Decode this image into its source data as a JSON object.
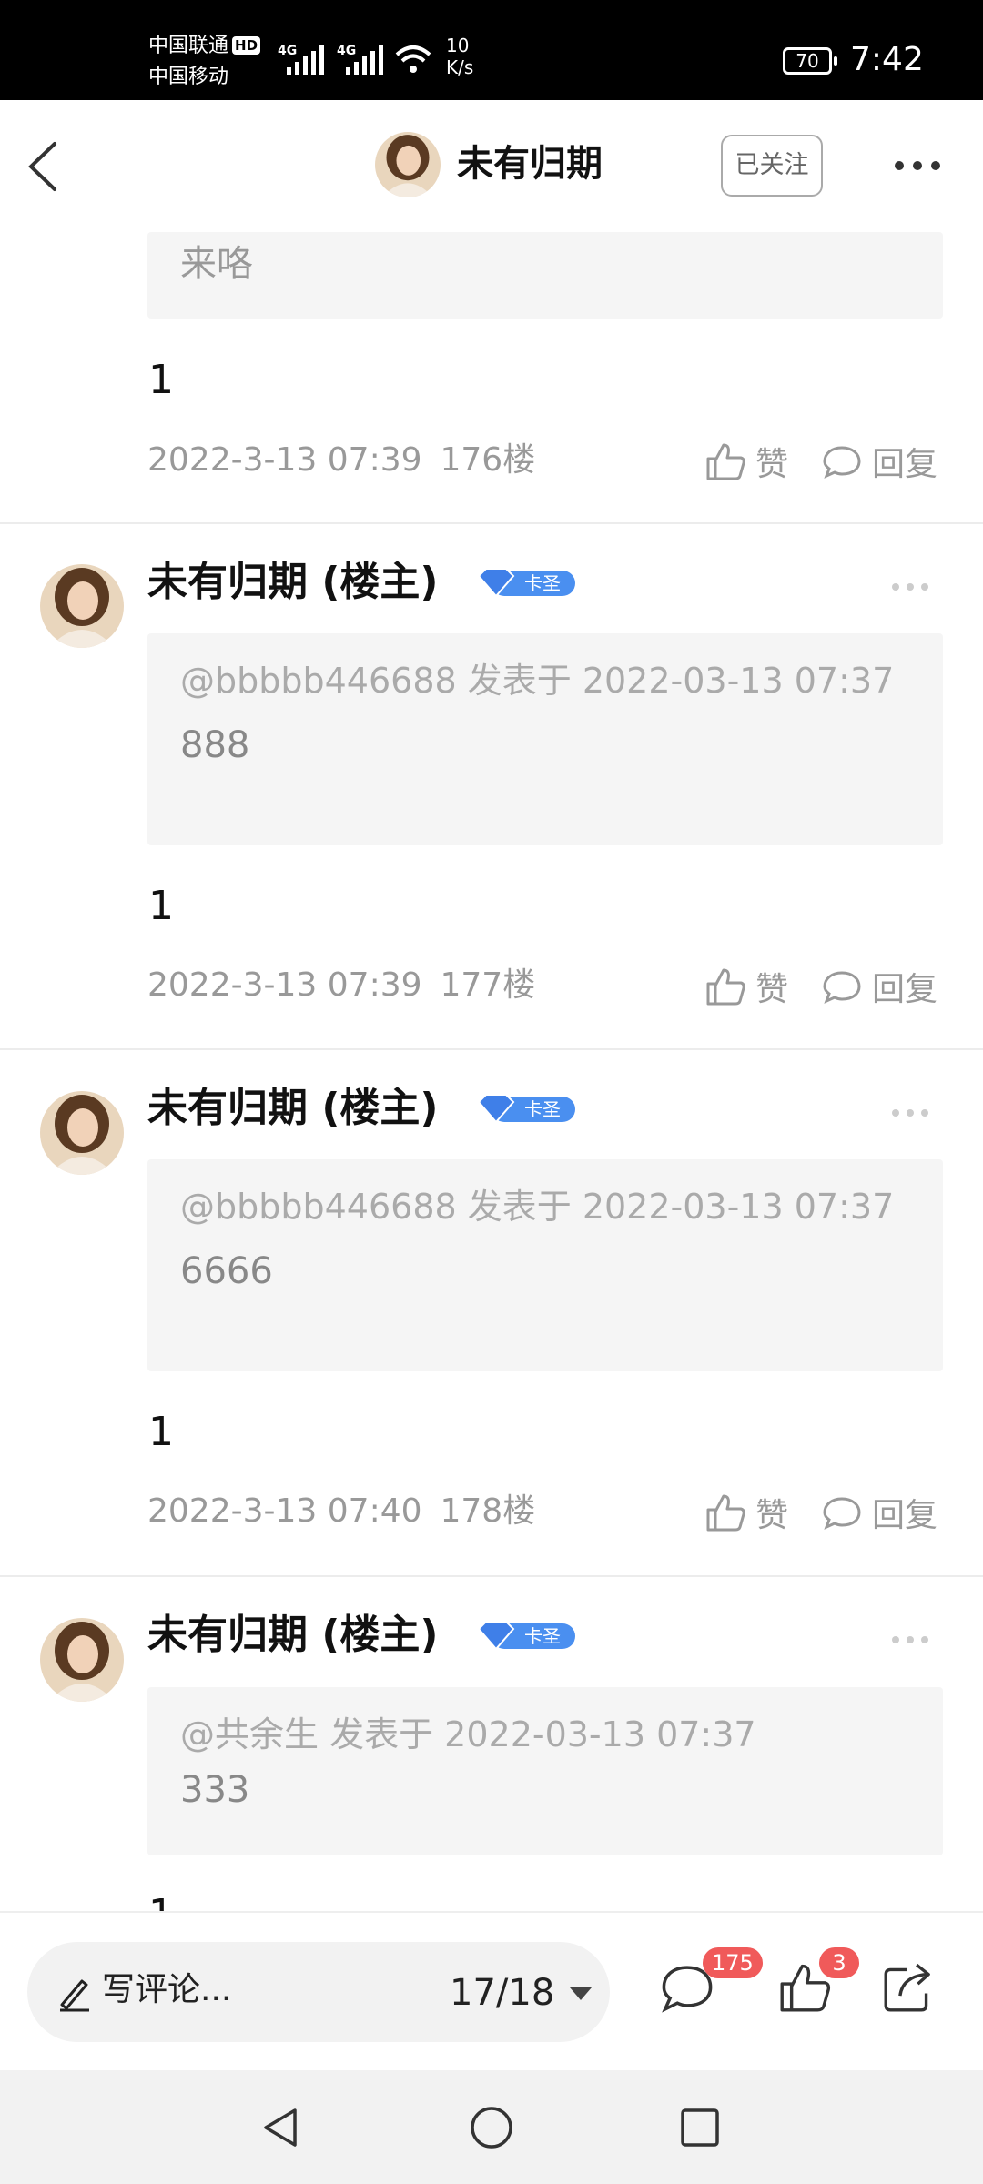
{
  "status_bar": {
    "carrier_1": "中国联通",
    "hd": "HD",
    "carrier_2": "中国移动",
    "net_1": "4G",
    "net_2": "4G",
    "speed_value": "10",
    "speed_unit": "K/s",
    "battery": "70",
    "time": "7:42"
  },
  "nav": {
    "back_icon": "chevron-left-icon",
    "title": "未有归期",
    "follow_label": "已关注",
    "more_icon": "more-dots-icon"
  },
  "partial_post": {
    "quote_text": "来咯",
    "body": "1",
    "date": "2022-3-13 07:39",
    "floor": "176楼"
  },
  "posts": [
    {
      "author": "未有归期 (楼主)",
      "badge": "卡圣",
      "quote_meta": "@bbbbb446688 发表于 2022-03-13 07:37",
      "quote_text": "888",
      "body": "1",
      "date": "2022-3-13 07:39",
      "floor": "177楼"
    },
    {
      "author": "未有归期 (楼主)",
      "badge": "卡圣",
      "quote_meta": "@bbbbb446688 发表于 2022-03-13 07:37",
      "quote_text": "6666",
      "body": "1",
      "date": "2022-3-13 07:40",
      "floor": "178楼"
    },
    {
      "author": "未有归期 (楼主)",
      "badge": "卡圣",
      "quote_meta": "@共余生 发表于 2022-03-13 07:37",
      "quote_text": "333",
      "body": "1"
    }
  ],
  "actions": {
    "like_label": "赞",
    "reply_label": "回复"
  },
  "bottom_bar": {
    "input_placeholder": "写评论...",
    "page_indicator": "17/18",
    "comment_count": "175",
    "like_count": "3",
    "icons": [
      "pen-icon",
      "caret-down-icon",
      "comment-icon",
      "thumbs-up-icon",
      "share-icon"
    ]
  },
  "system_nav": {
    "icons": [
      "back-triangle-icon",
      "home-circle-icon",
      "recents-square-icon"
    ]
  },
  "colors": {
    "badge_blue": "#4a8ff0",
    "count_badge_red": "#f05a5a",
    "quote_bg": "#f5f5f5",
    "meta_gray": "#999999"
  }
}
